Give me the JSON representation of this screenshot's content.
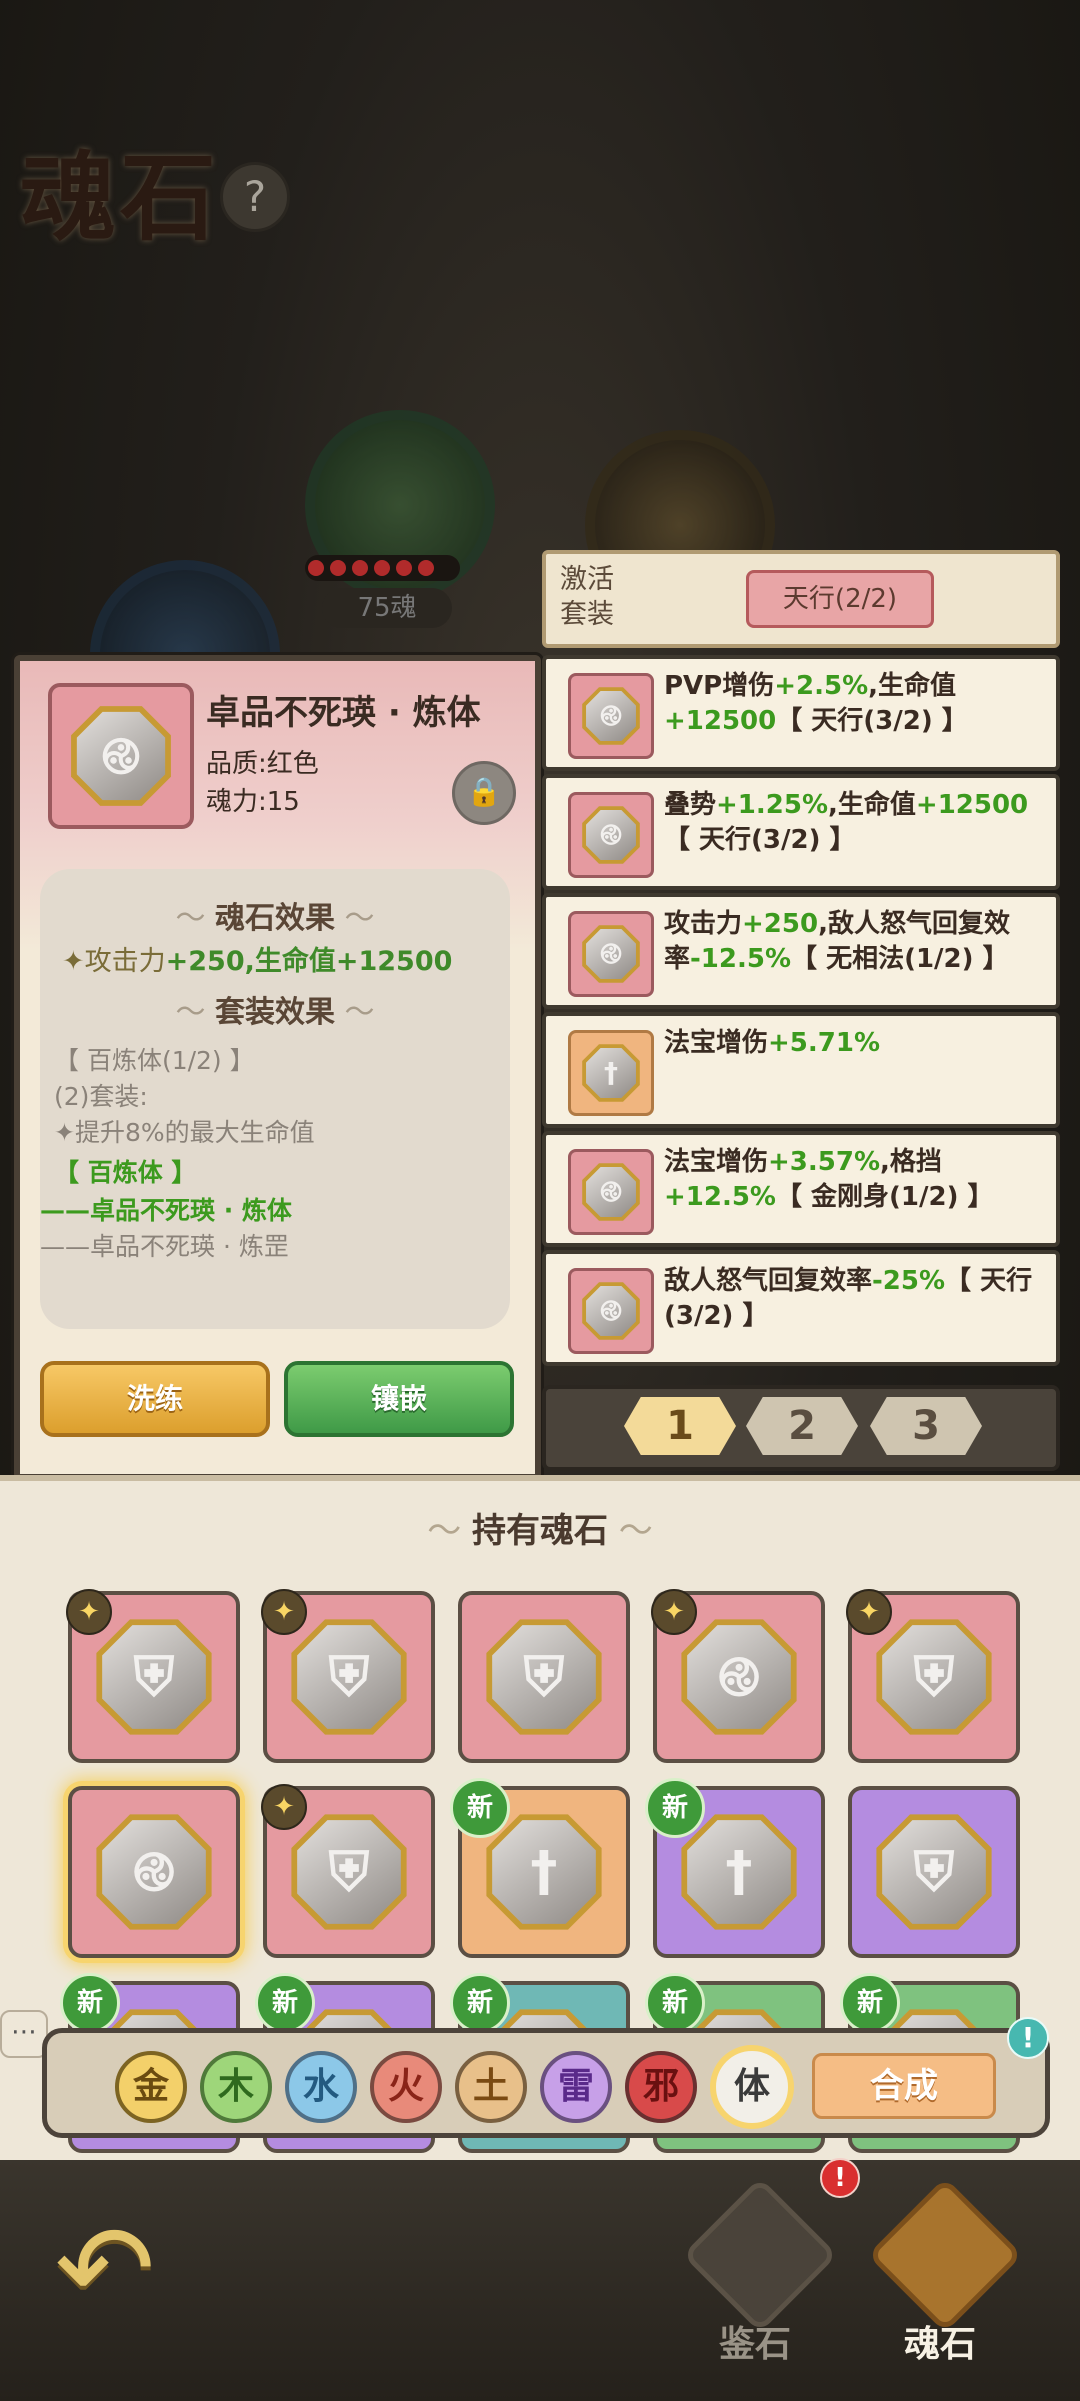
{
  "header": {
    "title": "魂石",
    "help_symbol": "?"
  },
  "background_orbs": {
    "soul_count_label": "75魂"
  },
  "activate": {
    "label": "激活套装",
    "value": "天行(2/2)"
  },
  "stone_detail": {
    "name": "卓品不死瑛 · 炼体",
    "quality": "品质:红色",
    "power": "魂力:15",
    "soul_effect_title": "魂石效果",
    "soul_effect_prefix": "攻击力",
    "soul_effect_value": "+250,生命值+12500",
    "set_effect_title": "套装效果",
    "set_lines": [
      "【 百炼体(1/2) 】",
      "(2)套装:",
      "提升8%的最大生命值"
    ],
    "set_members_title": "【 百炼体 】",
    "set_member_active": "——卓品不死瑛 · 炼体",
    "set_member_inactive": "——卓品不死瑛 · 炼罡",
    "refine_button": "洗练",
    "inlay_button": "镶嵌"
  },
  "equipped_cards": [
    {
      "a": "PVP增伤",
      "b": "+2.5%",
      "c": ",生命值",
      "d": "+12500",
      "e": "【 天行(3/2) 】",
      "icon": "triskelion-stone-icon",
      "color": "red"
    },
    {
      "a": "叠势",
      "b": "+1.25%",
      "c": ",生命值",
      "d": "+12500",
      "e": "【 天行(3/2) 】",
      "icon": "triskelion-stone-icon",
      "color": "red"
    },
    {
      "a": "攻击力",
      "b": "+250",
      "c": ",敌人怒气回复效率",
      "d": "-12.5%",
      "e": "【 无相法(1/2) 】",
      "icon": "triskelion-stone-icon",
      "color": "red"
    },
    {
      "a": "法宝增伤",
      "b": "+5.71%",
      "c": "",
      "d": "",
      "e": "",
      "icon": "sword-stone-icon",
      "color": "orange"
    },
    {
      "a": "法宝增伤",
      "b": "+3.57%",
      "c": ",格挡",
      "d": "+12.5%",
      "e": "【 金刚身(1/2) 】",
      "icon": "triskelion-stone-icon",
      "color": "red"
    },
    {
      "a": "敌人怒气回复效率",
      "b": "-25%",
      "c": "",
      "d": "",
      "e": "【 天行(3/2) 】",
      "icon": "triskelion-stone-icon",
      "color": "red"
    }
  ],
  "page_tabs": [
    "1",
    "2",
    "3"
  ],
  "inventory": {
    "title": "持有魂石",
    "new_label": "新",
    "slots": [
      {
        "color": "red",
        "icon": "shield-stone-icon",
        "star": true,
        "new": false
      },
      {
        "color": "red",
        "icon": "shield-stone-icon",
        "star": true,
        "new": false
      },
      {
        "color": "red",
        "icon": "shield-stone-icon",
        "star": false,
        "new": false
      },
      {
        "color": "red",
        "icon": "triskelion-stone-icon",
        "star": true,
        "new": false
      },
      {
        "color": "red",
        "icon": "shield-stone-icon",
        "star": true,
        "new": false
      },
      {
        "color": "red",
        "icon": "triskelion-stone-icon",
        "star": false,
        "new": false,
        "selected": true
      },
      {
        "color": "red",
        "icon": "shield-stone-icon",
        "star": true,
        "new": false
      },
      {
        "color": "orange",
        "icon": "sword-stone-icon",
        "star": false,
        "new": true
      },
      {
        "color": "purple",
        "icon": "sword-stone-icon",
        "star": false,
        "new": true
      },
      {
        "color": "purple",
        "icon": "shield-stone-icon",
        "star": false,
        "new": false
      },
      {
        "color": "purple",
        "icon": "stone-icon",
        "star": false,
        "new": true
      },
      {
        "color": "purple",
        "icon": "stone-icon",
        "star": false,
        "new": true
      },
      {
        "color": "teal",
        "icon": "stone-icon",
        "star": false,
        "new": true
      },
      {
        "color": "green",
        "icon": "stone-icon",
        "star": false,
        "new": true
      },
      {
        "color": "green",
        "icon": "stone-icon",
        "star": false,
        "new": true
      }
    ]
  },
  "filters": {
    "elements": [
      "金",
      "木",
      "水",
      "火",
      "土",
      "雷",
      "邪",
      "体"
    ],
    "combine_button": "合成",
    "combine_alert": "!"
  },
  "bottom_nav": {
    "appraise_label": "鉴石",
    "soulstone_label": "魂石",
    "alert": "!"
  }
}
